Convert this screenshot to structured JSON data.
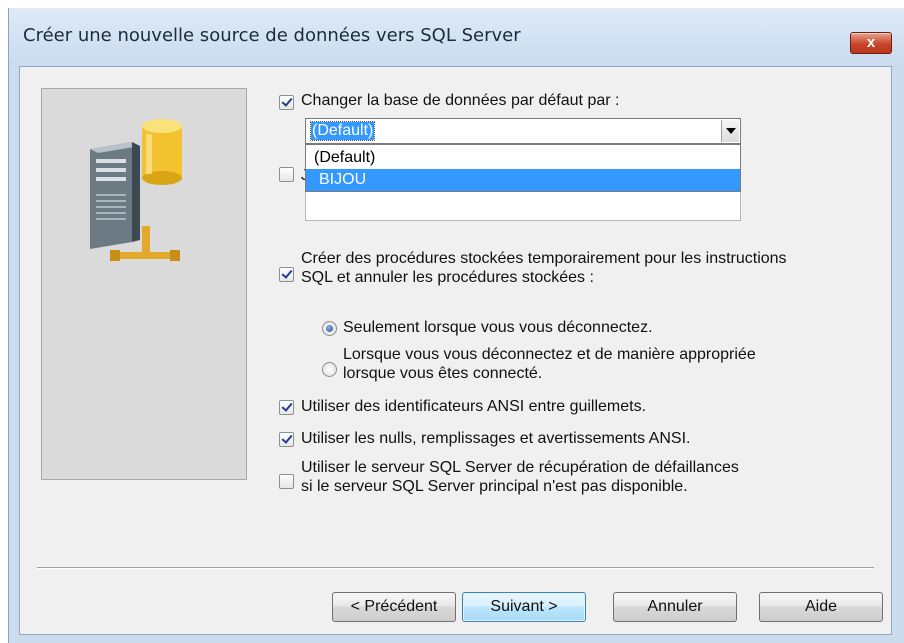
{
  "window": {
    "title": "Créer une nouvelle source de données vers SQL Server",
    "close_label": "x"
  },
  "options": {
    "change_default_db": {
      "label": "Changer la base de données par défaut par :",
      "checked": true
    },
    "hidden_option": {
      "label": "J",
      "checked": false
    },
    "temp_procedures": {
      "line1": "Créer des procédures stockées temporairement pour les instructions",
      "line2": "SQL et annuler les procédures stockées :",
      "checked": true
    },
    "radio_disconnect": {
      "label": "Seulement lorsque vous vous déconnectez.",
      "selected": true
    },
    "radio_appropriate": {
      "line1": "Lorsque vous vous déconnectez et de manière appropriée",
      "line2": "lorsque vous êtes connecté.",
      "selected": false
    },
    "ansi_quoted": {
      "label": "Utiliser des identificateurs ANSI entre guillemets.",
      "checked": true
    },
    "ansi_nulls": {
      "label": "Utiliser les nulls, remplissages et avertissements ANSI.",
      "checked": true
    },
    "failover": {
      "line1": "Utiliser le serveur SQL Server de récupération de défaillances",
      "line2": "si le serveur SQL Server principal n'est pas disponible.",
      "checked": false
    }
  },
  "database_combo": {
    "value": "(Default)",
    "options": [
      "(Default)",
      "BIJOU"
    ],
    "highlighted": "BIJOU"
  },
  "buttons": {
    "back": "< Précédent",
    "next": "Suivant >",
    "cancel": "Annuler",
    "help": "Aide"
  },
  "colors": {
    "selection": "#3399ff",
    "title_bar": "#cbdcef",
    "close_button": "#c9452b"
  },
  "icons": {
    "server": "database-server-icon",
    "combo_arrow": "chevron-down-icon",
    "close": "close-icon"
  }
}
